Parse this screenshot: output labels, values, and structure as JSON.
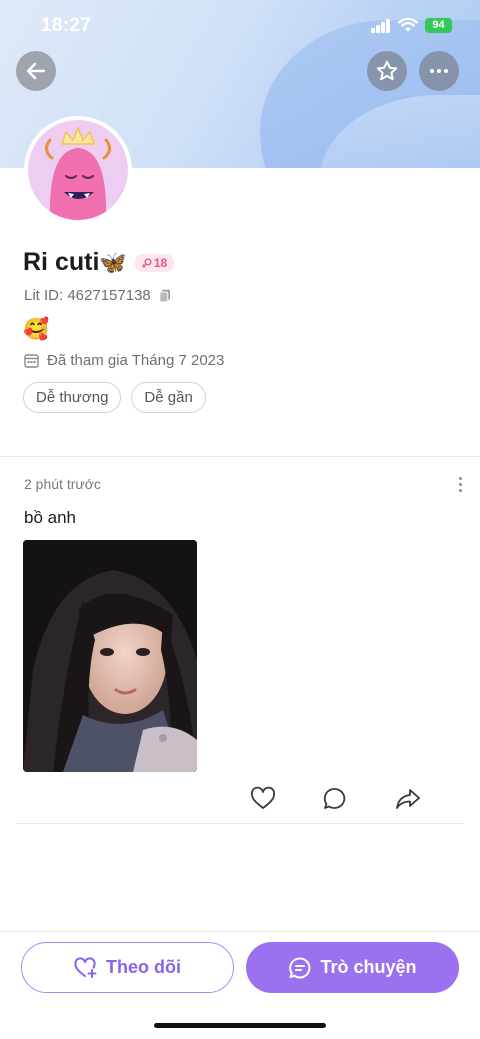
{
  "status_bar": {
    "time": "18:27",
    "battery": "94"
  },
  "profile": {
    "name": "Ri cuti",
    "name_emoji": "🦋",
    "age": "18",
    "lit_id": "Lit ID: 4627157138",
    "bio_emoji": "🥰",
    "joined": "Đã tham gia Tháng 7 2023",
    "tags": [
      "Dễ thương",
      "Dễ gần"
    ]
  },
  "post": {
    "time": "2 phút trước",
    "text": "bồ anh"
  },
  "bottom": {
    "follow_label": "Theo dõi",
    "chat_label": "Trò chuyện"
  },
  "icons": {
    "back": "arrow-left-icon",
    "favorite": "star-icon",
    "more": "more-horizontal-icon",
    "copy": "copy-icon",
    "calendar": "calendar-icon",
    "like": "heart-icon",
    "comment": "comment-icon",
    "share": "share-icon",
    "follow": "heart-plus-icon",
    "chat": "chat-icon"
  },
  "colors": {
    "accent": "#9a72f0",
    "age_badge": "#e8548a",
    "battery": "#34c759"
  }
}
